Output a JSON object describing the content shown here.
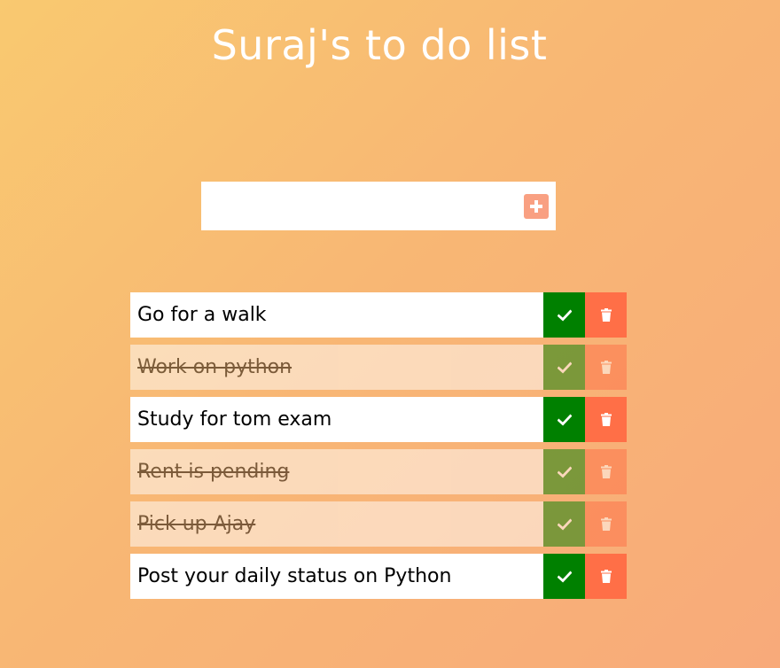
{
  "header": {
    "title": "Suraj's to do list"
  },
  "add_form": {
    "input_value": "",
    "input_placeholder": "",
    "add_icon": "plus-square-icon"
  },
  "todos": [
    {
      "text": "Go for a walk",
      "completed": false
    },
    {
      "text": "Work on python",
      "completed": true
    },
    {
      "text": "Study for tom exam",
      "completed": false
    },
    {
      "text": "Rent is pending",
      "completed": true
    },
    {
      "text": "Pick up Ajay",
      "completed": true
    },
    {
      "text": "Post your daily status on Python",
      "completed": false
    }
  ],
  "icons": {
    "complete": "check-icon",
    "delete": "trash-icon"
  },
  "colors": {
    "complete_button": "#008000",
    "delete_button": "#ff6f47",
    "add_button": "#f9a082",
    "title_text": "#ffffff"
  }
}
